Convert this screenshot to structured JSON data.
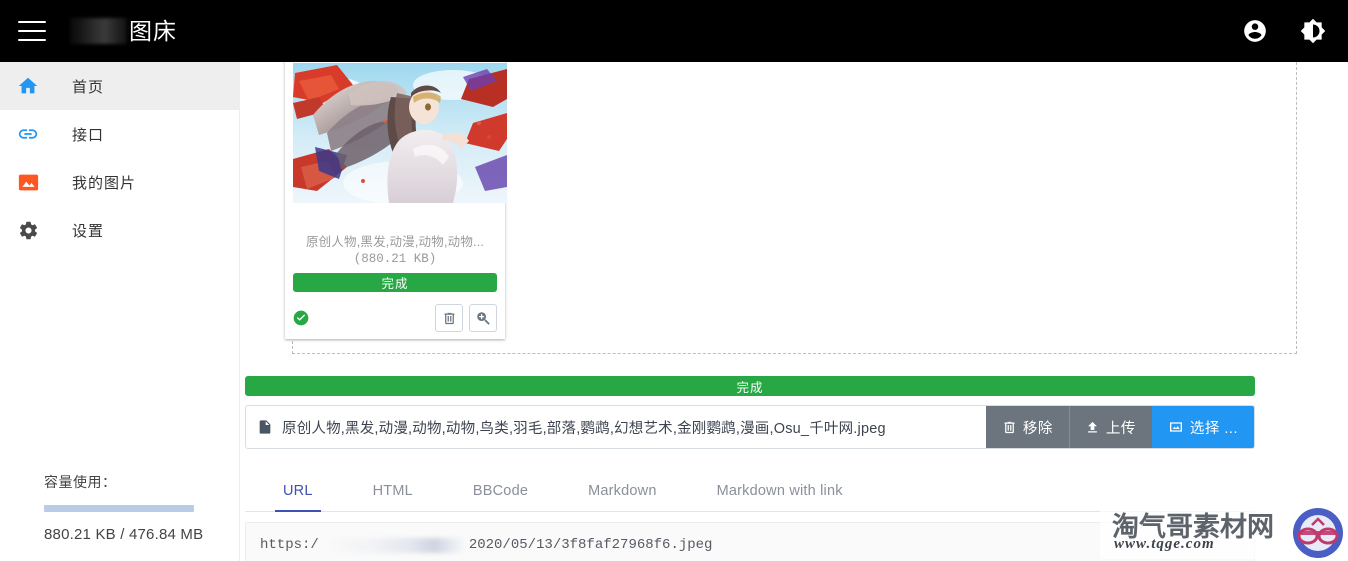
{
  "header": {
    "menu_icon": "hamburger-menu-icon",
    "brand_redacted": "",
    "brand_title": "图床",
    "account_icon": "account-circle-icon",
    "theme_icon": "brightness-contrast-icon"
  },
  "sidebar": {
    "items": [
      {
        "label": "首页",
        "icon": "home-icon",
        "color": "#2196f3",
        "active": true
      },
      {
        "label": "接口",
        "icon": "link-icon",
        "color": "#2196f3",
        "active": false
      },
      {
        "label": "我的图片",
        "icon": "image-icon",
        "color": "#ff5722",
        "active": false
      },
      {
        "label": "设置",
        "icon": "gear-icon",
        "color": "#4a4a4a",
        "active": false
      }
    ],
    "capacity": {
      "title": "容量使用：",
      "used_text": "880.21 KB / 476.84 MB",
      "percent": 0.18
    }
  },
  "main": {
    "card": {
      "file_name": "原创人物,黑发,动漫,动物,动物...",
      "file_size": "(880.21 KB)",
      "progress_label": "完成",
      "status_icon": "check-circle-icon",
      "delete_icon": "trash-icon",
      "zoom_icon": "magnify-plus-icon"
    },
    "upload": {
      "progress_label": "完成",
      "file_icon": "file-document-icon",
      "file_name": "原创人物,黑发,动漫,动物,动物,鸟类,羽毛,部落,鹦鹉,幻想艺术,金刚鹦鹉,漫画,Osu_千叶网.jpeg",
      "remove_label": "移除",
      "remove_icon": "trash-icon",
      "upload_label": "上传",
      "upload_icon": "upload-icon",
      "select_label": "选择 ...",
      "select_icon": "image-multiple-icon"
    },
    "tabs": [
      {
        "label": "URL",
        "active": true
      },
      {
        "label": "HTML",
        "active": false
      },
      {
        "label": "BBCode",
        "active": false
      },
      {
        "label": "Markdown",
        "active": false
      },
      {
        "label": "Markdown with link",
        "active": false
      }
    ],
    "url_value_prefix": "https:/",
    "url_value_suffix": "2020/05/13/3f8faf27968f6.jpeg"
  },
  "watermark": {
    "title": "淘气哥素材网",
    "url": "www.tqge.com",
    "logo_icon": "glasses-logo-icon"
  },
  "colors": {
    "appbar": "#000000",
    "accent_blue": "#2196f3",
    "tab_active": "#3f51b5",
    "success_green": "#28a745",
    "button_grey": "#6c757d",
    "image_orange": "#ff5722"
  }
}
